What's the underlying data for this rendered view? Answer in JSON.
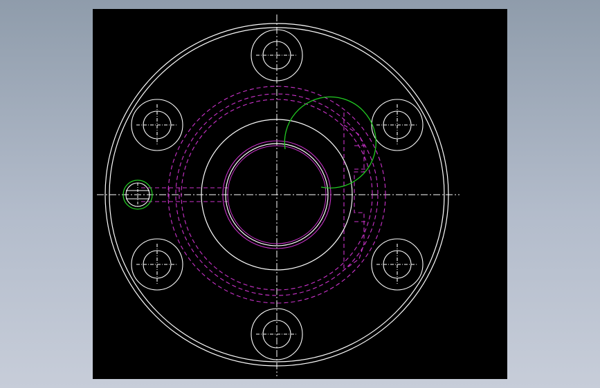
{
  "drawing": {
    "background_color": "#8f9cab",
    "canvas_color": "#000000",
    "colors": {
      "outline": "#ffffff",
      "centerline": "#ffffff",
      "hidden_line": "#cc33cc",
      "thread": "#22cc22"
    },
    "features": {
      "outer_flange": "outer-circle",
      "bolt_holes": 6,
      "bore": "center-bore",
      "pin_hole": "side-pin-hole",
      "hidden_recess": "dashed-hidden-lines"
    }
  }
}
